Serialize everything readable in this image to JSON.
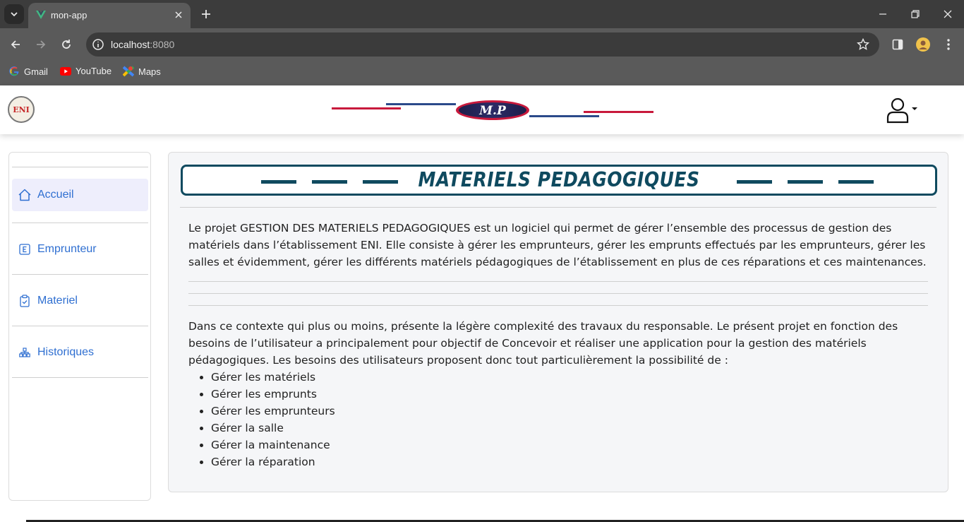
{
  "browser": {
    "tab_title": "mon-app",
    "url_host": "localhost",
    "url_port": ":8080",
    "bookmarks": [
      {
        "label": "Gmail",
        "icon": "google-icon"
      },
      {
        "label": "YouTube",
        "icon": "youtube-icon"
      },
      {
        "label": "Maps",
        "icon": "maps-icon"
      }
    ]
  },
  "header": {
    "logo_text": "ENI",
    "brand_text": "M.P"
  },
  "sidebar": {
    "items": [
      {
        "label": "Accueil",
        "icon": "home-icon",
        "active": true
      },
      {
        "label": "Emprunteur",
        "icon": "letter-e-icon",
        "active": false
      },
      {
        "label": "Materiel",
        "icon": "clipboard-icon",
        "active": false
      },
      {
        "label": "Historiques",
        "icon": "hierarchy-icon",
        "active": false
      }
    ]
  },
  "main": {
    "title": "MATERIELS PEDAGOGIQUES",
    "paragraph1": "Le projet GESTION DES MATERIELS PEDAGOGIQUES est un logiciel qui permet de gérer l’ensemble des processus de gestion des matériels dans l’établissement ENI. Elle consiste à gérer les emprunteurs, gérer les emprunts effectués par les emprunteurs, gérer les salles et évidemment, gérer les différents matériels pédagogiques de l’établissement en plus de ces réparations et ces maintenances.",
    "paragraph2": "Dans ce contexte qui plus ou moins, présente la légère complexité des travaux du responsable. Le présent projet en fonction des besoins de l’utilisateur a principalement pour objectif de Concevoir et réaliser une application pour la gestion des matériels pédagogiques. Les besoins des utilisateurs proposent donc tout particulièrement la possibilité de :",
    "list": [
      "Gérer les matériels",
      "Gérer les emprunts",
      "Gérer les emprunteurs",
      "Gérer la salle",
      "Gérer la maintenance",
      "Gérer la réparation"
    ]
  },
  "colors": {
    "accent_blue": "#2f6fd1",
    "banner_teal": "#0f4a5f",
    "brand_red": "#c8193c",
    "brand_navy": "#2b4a8a"
  }
}
